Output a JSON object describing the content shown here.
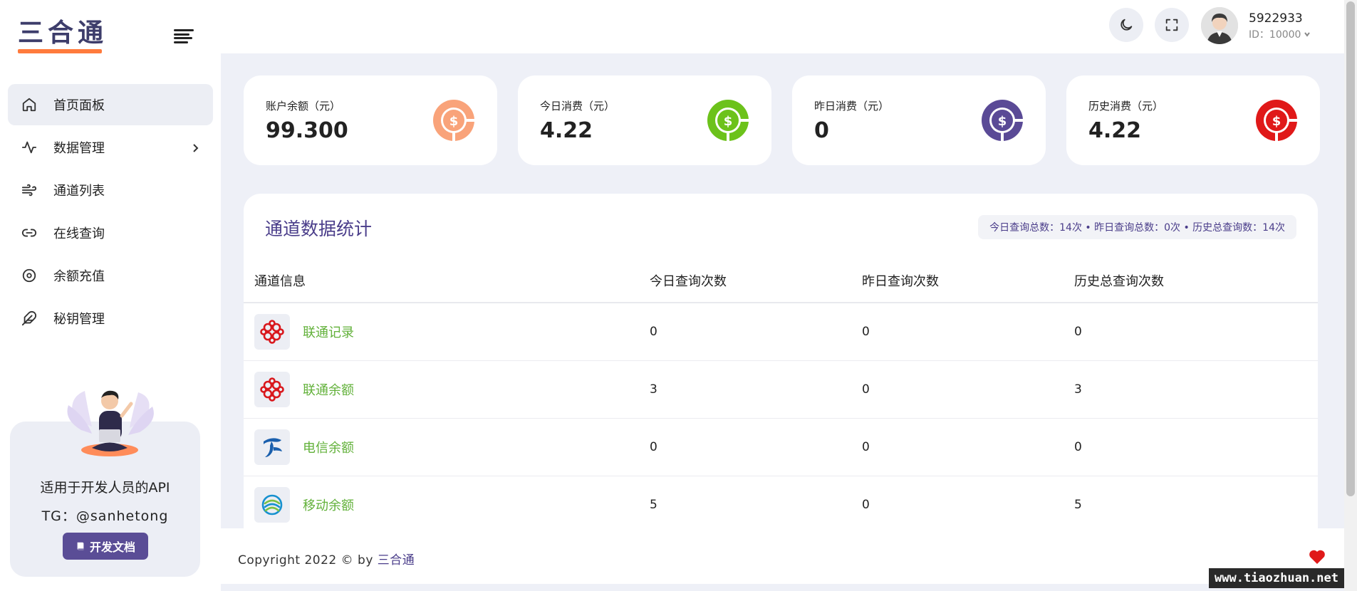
{
  "app": {
    "logo_text": "三合通"
  },
  "sidebar": {
    "items": [
      {
        "label": "首页面板",
        "icon": "home-icon"
      },
      {
        "label": "数据管理",
        "icon": "activity-icon"
      },
      {
        "label": "通道列表",
        "icon": "wind-icon"
      },
      {
        "label": "在线查询",
        "icon": "link-icon"
      },
      {
        "label": "余额充值",
        "icon": "target-icon"
      },
      {
        "label": "秘钥管理",
        "icon": "feather-icon"
      }
    ],
    "promo": {
      "line1": "适用于开发人员的API",
      "line2": "TG：@sanhetong",
      "button": "开发文档"
    }
  },
  "header": {
    "user_name": "5922933",
    "user_id": "ID：10000"
  },
  "stats": [
    {
      "label": "账户余额（元）",
      "value": "99.300",
      "color": "#f9a37a"
    },
    {
      "label": "今日消费（元）",
      "value": "4.22",
      "color": "#6cc21b"
    },
    {
      "label": "昨日消费（元）",
      "value": "0",
      "color": "#5a4a96"
    },
    {
      "label": "历史消费（元）",
      "value": "4.22",
      "color": "#e01919"
    }
  ],
  "panel": {
    "title": "通道数据统计",
    "summary": "今日查询总数：14次 • 昨日查询总数：0次 • 历史总查询数：14次",
    "columns": [
      "通道信息",
      "今日查询次数",
      "昨日查询次数",
      "历史总查询次数"
    ],
    "rows": [
      {
        "name": "联通记录",
        "logo": "unicom-logo",
        "today": "0",
        "yesterday": "0",
        "total": "0"
      },
      {
        "name": "联通余额",
        "logo": "unicom-logo",
        "today": "3",
        "yesterday": "0",
        "total": "3"
      },
      {
        "name": "电信余额",
        "logo": "telecom-logo",
        "today": "0",
        "yesterday": "0",
        "total": "0"
      },
      {
        "name": "移动余额",
        "logo": "mobile-logo",
        "today": "5",
        "yesterday": "0",
        "total": "5"
      }
    ]
  },
  "footer": {
    "prefix": "Copyright 2022 © by ",
    "link": "三合通"
  },
  "watermark": "www.tiaozhuan.net"
}
